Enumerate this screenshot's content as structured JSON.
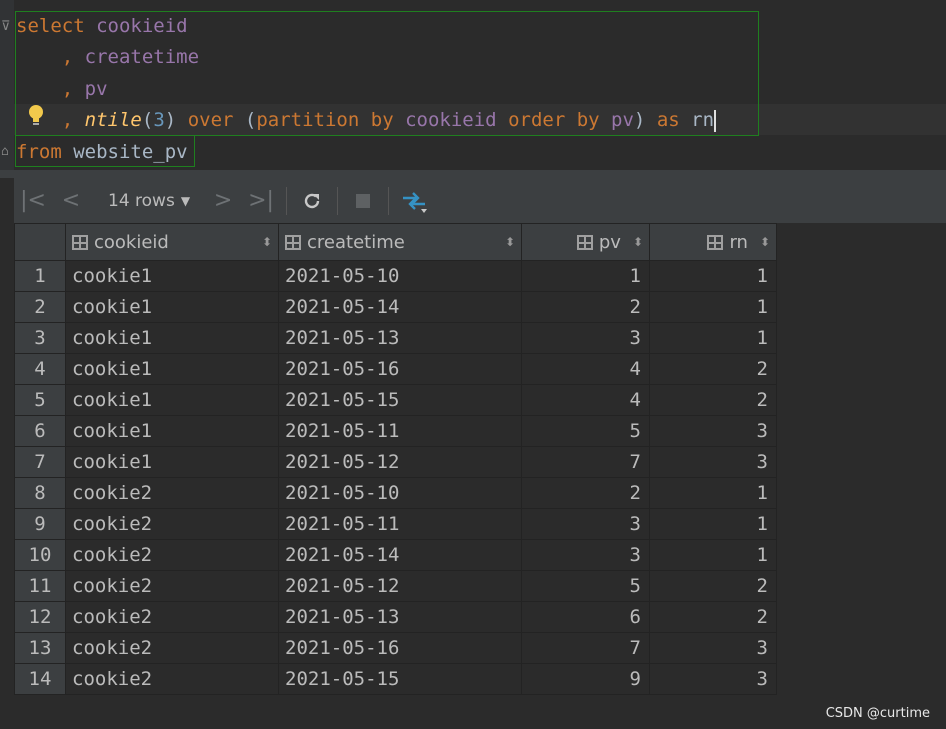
{
  "editor": {
    "line1": {
      "kw": "select",
      "col": "cookieid"
    },
    "line2": {
      "comma": ",",
      "col": "createtime"
    },
    "line3": {
      "comma": ",",
      "col": "pv"
    },
    "line4": {
      "comma": ",",
      "fn": "ntile",
      "arg": "3",
      "over": "over",
      "partition": "partition by",
      "pcol": "cookieid",
      "order": "order by",
      "ocol": "pv",
      "as": "as",
      "alias": "rn"
    },
    "line5": {
      "kw": "from",
      "table": "website_pv"
    }
  },
  "toolbar": {
    "rows_label": "14 rows",
    "icons": [
      "first-page-icon",
      "prev-page-icon",
      "next-page-icon",
      "last-page-icon",
      "refresh-icon",
      "stop-icon",
      "compare-icon"
    ]
  },
  "grid": {
    "columns": [
      "cookieid",
      "createtime",
      "pv",
      "rn"
    ],
    "rows": [
      [
        "1",
        "cookie1",
        "2021-05-10",
        "1",
        "1"
      ],
      [
        "2",
        "cookie1",
        "2021-05-14",
        "2",
        "1"
      ],
      [
        "3",
        "cookie1",
        "2021-05-13",
        "3",
        "1"
      ],
      [
        "4",
        "cookie1",
        "2021-05-16",
        "4",
        "2"
      ],
      [
        "5",
        "cookie1",
        "2021-05-15",
        "4",
        "2"
      ],
      [
        "6",
        "cookie1",
        "2021-05-11",
        "5",
        "3"
      ],
      [
        "7",
        "cookie1",
        "2021-05-12",
        "7",
        "3"
      ],
      [
        "8",
        "cookie2",
        "2021-05-10",
        "2",
        "1"
      ],
      [
        "9",
        "cookie2",
        "2021-05-11",
        "3",
        "1"
      ],
      [
        "10",
        "cookie2",
        "2021-05-14",
        "3",
        "1"
      ],
      [
        "11",
        "cookie2",
        "2021-05-12",
        "5",
        "2"
      ],
      [
        "12",
        "cookie2",
        "2021-05-13",
        "6",
        "2"
      ],
      [
        "13",
        "cookie2",
        "2021-05-16",
        "7",
        "3"
      ],
      [
        "14",
        "cookie2",
        "2021-05-15",
        "9",
        "3"
      ]
    ]
  },
  "watermark": "CSDN @curtime"
}
